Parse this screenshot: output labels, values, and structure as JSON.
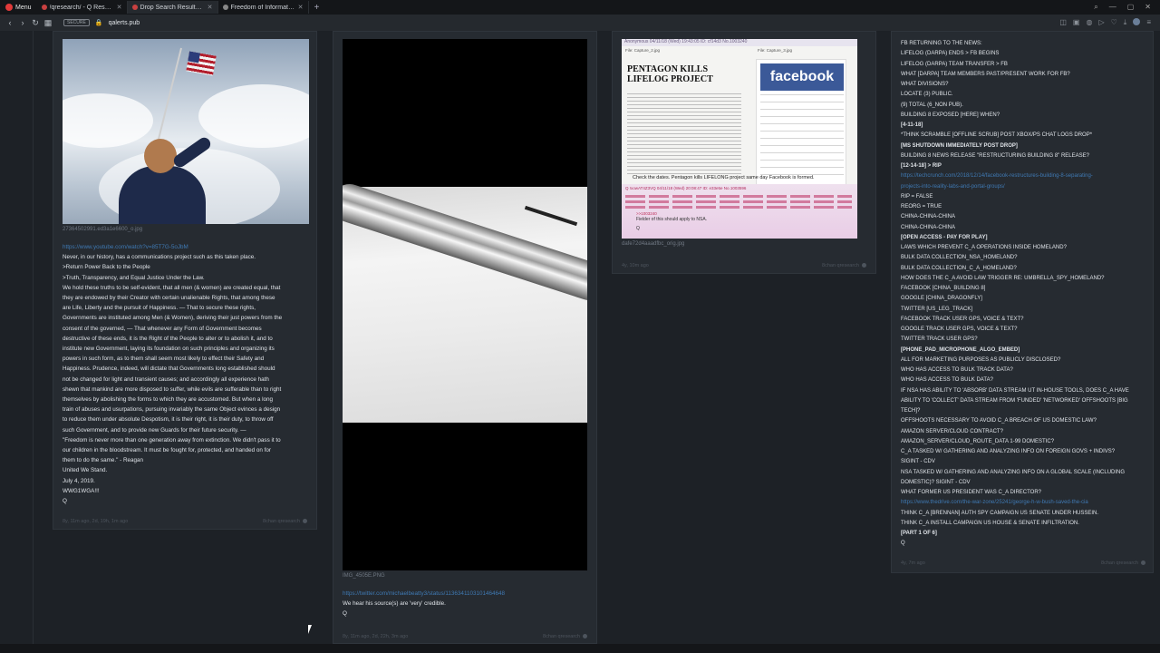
{
  "browser": {
    "menu_label": "Menu",
    "tabs": [
      {
        "title": "/qresearch/ - Q Research Ge..."
      },
      {
        "title": "Drop Search Results: Mar 1..."
      },
      {
        "title": "Freedom of Information A..."
      }
    ],
    "new_tab_label": "+",
    "url": "qalerts.pub",
    "url_badge": "SECURE"
  },
  "posts": [
    {
      "filename": "27364502991.ed3a1e6600_o.jpg",
      "link": "https://www.youtube.com/watch?v=85T7G-5oJbM",
      "lines": [
        "Never, in our history, has a communications project such as this taken place.",
        ">Return Power Back to the People",
        ">Truth, Transparency, and Equal Justice Under the Law.",
        "We hold these truths to be self-evident, that all men (& women) are created equal, that",
        "they are endowed by their Creator with certain unalienable Rights, that among these",
        "are Life, Liberty and the pursuit of Happiness. — That to secure these rights,",
        "Governments are instituted among Men (& Women), deriving their just powers from the",
        "consent of the governed, — That whenever any Form of Government becomes",
        "destructive of these ends, it is the Right of the People to alter or to abolish it, and to",
        "institute new Government, laying its foundation on such principles and organizing its",
        "powers in such form, as to them shall seem most likely to effect their Safety and",
        "Happiness. Prudence, indeed, will dictate that Governments long established should",
        "not be changed for light and transient causes; and accordingly all experience hath",
        "shewn that mankind are more disposed to suffer, while evils are sufferable than to right",
        "themselves by abolishing the forms to which they are accustomed. But when a long",
        "train of abuses and usurpations, pursuing invariably the same Object evinces a design",
        "to reduce them under absolute Despotism, it is their right, it is their duty, to throw off",
        "such Government, and to provide new Guards for their future security. —",
        "\"Freedom is never more than one generation away from extinction. We didn't pass it to",
        "our children in the bloodstream. It must be fought for, protected, and handed on for",
        "them to do the same.\" - Reagan",
        "United We Stand.",
        "July 4, 2019.",
        "WWG1WGA!!!",
        "Q"
      ],
      "meta_left": "8y, 11m ago, 2d, 19h, 1m ago",
      "meta_right": "8chan qresearch"
    },
    {
      "filename": "IMG_4505E.PNG",
      "link": "https://twitter.com/michaelbeatty3/status/1136341103101464648",
      "lines": [
        "We hear his source(s) are 'very' credible.",
        "Q"
      ],
      "meta_left": "8y, 11m ago, 2d, 22h, 3m ago",
      "meta_right": "8chan qresearch"
    },
    {
      "image_header": "Anonymous 04/11/18 (Wed) 19:43:05 ID: cf14d3 No.1003240",
      "image_file_left": "File: Capture_2.jpg",
      "image_file_right": "File: Capture_3.jpg",
      "image_headline": "PENTAGON KILLS LIFELOG PROJECT",
      "image_brand": "facebook",
      "image_check": "Check the dates.  Pentagon kills LIFELONG project same day Facebook is formed.",
      "image_q_line": "Q !xowAT4Z3VQ  04/11/18 (Wed) 20:08:47 ID: e33e5e No.1003596",
      "image_ref": ">>1003240",
      "image_footer": "Fielder of this should apply to NSA.",
      "image_sign": "Q",
      "filename": "dafe72d4aaadfbc_orig.jpg",
      "meta_left": "4y, 10m ago",
      "meta_right": "8chan qresearch"
    },
    {
      "lines": [
        {
          "t": "FB RETURNING TO THE NEWS:",
          "b": false
        },
        {
          "t": "LIFELOG (DARPA) ENDS > FB BEGINS",
          "b": false
        },
        {
          "t": "LIFELOG (DARPA) TEAM TRANSFER > FB",
          "b": false
        },
        {
          "t": "WHAT [DARPA] TEAM MEMBERS PAST/PRESENT WORK FOR FB?",
          "b": false
        },
        {
          "t": "WHAT DIVISIONS?",
          "b": false
        },
        {
          "t": "LOCATE (3) PUBLIC.",
          "b": false
        },
        {
          "t": "(9) TOTAL (6_NON PUB).",
          "b": false
        },
        {
          "t": "BUILDING 8 EXPOSED [HERE] WHEN?",
          "b": false
        },
        {
          "t": "[4-11-18]",
          "b": true
        },
        {
          "t": "*THINK SCRAMBLE [OFFLINE SCRUB] POST XBOX/PS CHAT LOGS DROP*",
          "b": false
        },
        {
          "t": "[MS SHUTDOWN IMMEDIATELY POST DROP]",
          "b": true
        },
        {
          "t": "BUILDING 8 NEWS RELEASE \"RESTRUCTURING BUILDING 8\" RELEASE?",
          "b": false
        },
        {
          "t": "[12-14-18] > RIP",
          "b": true
        },
        {
          "t": "https://techcrunch.com/2018/12/14/facebook-restructures-building-8-separating-",
          "b": false,
          "link": true
        },
        {
          "t": "projects-into-reality-labs-and-portal-groups/",
          "b": false,
          "link": true
        },
        {
          "t": "RIP = FALSE",
          "b": false
        },
        {
          "t": "REORG = TRUE",
          "b": false
        },
        {
          "t": "CHINA-CHINA-CHINA",
          "b": false
        },
        {
          "t": "CHINA-CHINA-CHINA",
          "b": false
        },
        {
          "t": "[OPEN ACCESS - PAY FOR PLAY]",
          "b": true
        },
        {
          "t": "LAWS WHICH PREVENT C_A OPERATIONS INSIDE HOMELAND?",
          "b": false
        },
        {
          "t": "BULK DATA COLLECTION_NSA_HOMELAND?",
          "b": false
        },
        {
          "t": "BULK DATA COLLECTION_C_A_HOMELAND?",
          "b": false
        },
        {
          "t": "HOW DOES THE C_A AVOID LAW TRIGGER RE: UMBRELLA_SPY_HOMELAND?",
          "b": false
        },
        {
          "t": "FACEBOOK [CHINA_BUILDING 8]",
          "b": false
        },
        {
          "t": "GOOGLE [CHINA_DRAGONFLY]",
          "b": false
        },
        {
          "t": "TWITTER [US_LEG_TRACK]",
          "b": false
        },
        {
          "t": "FACEBOOK TRACK USER GPS, VOICE & TEXT?",
          "b": false
        },
        {
          "t": "GOOGLE TRACK USER GPS, VOICE & TEXT?",
          "b": false
        },
        {
          "t": "TWITTER TRACK USER GPS?",
          "b": false
        },
        {
          "t": "[PHONE_PAD_MICROPHONE_ALGO_EMBED]",
          "b": true
        },
        {
          "t": "ALL FOR MARKETING PURPOSES AS PUBLICLY DISCLOSED?",
          "b": false
        },
        {
          "t": "WHO HAS ACCESS TO BULK TRACK DATA?",
          "b": false
        },
        {
          "t": "WHO HAS ACCESS TO BULK DATA?",
          "b": false
        },
        {
          "t": "IF NSA HAS ABILITY TO 'ABSORB' DATA STREAM UT IN-HOUSE TOOLS, DOES C_A HAVE",
          "b": false
        },
        {
          "t": "ABILITY TO 'COLLECT' DATA STREAM FROM 'FUNDED' 'NETWORKED' OFFSHOOTS [BIG",
          "b": false
        },
        {
          "t": "TECH]?",
          "b": false
        },
        {
          "t": "OFFSHOOTS NECESSARY TO AVOID C_A BREACH OF US DOMESTIC LAW?",
          "b": false
        },
        {
          "t": "AMAZON SERVER/CLOUD CONTRACT?",
          "b": false
        },
        {
          "t": "AMAZON_SERVER/CLOUD_ROUTE_DATA 1-99 DOMESTIC?",
          "b": false
        },
        {
          "t": "C_A TASKED W/ GATHERING AND ANALYZING INFO ON FOREIGN GOVS + INDIVS?",
          "b": false
        },
        {
          "t": "SIGINT - CDV",
          "b": false
        },
        {
          "t": "NSA TASKED W/ GATHERING AND ANALYZING INFO ON A GLOBAL SCALE (INCLUDING",
          "b": false
        },
        {
          "t": "DOMESTIC)? SIGINT - CDV",
          "b": false
        },
        {
          "t": "WHAT FORMER US PRESIDENT WAS C_A DIRECTOR?",
          "b": false
        },
        {
          "t": "https://www.thedrive.com/the-war-zone/25241/george-h-w-bush-saved-the-cia",
          "b": false,
          "link": true
        },
        {
          "t": "THINK C_A [BRENNAN] AUTH SPY CAMPAIGN US SENATE UNDER HUSSEIN.",
          "b": false
        },
        {
          "t": "THINK C_A INSTALL CAMPAIGN US HOUSE & SENATE INFILTRATION.",
          "b": false
        },
        {
          "t": "[PART 1 OF 6]",
          "b": true
        },
        {
          "t": "Q",
          "b": false
        }
      ],
      "meta_left": "4y, 7m ago",
      "meta_right": "8chan qresearch"
    }
  ]
}
